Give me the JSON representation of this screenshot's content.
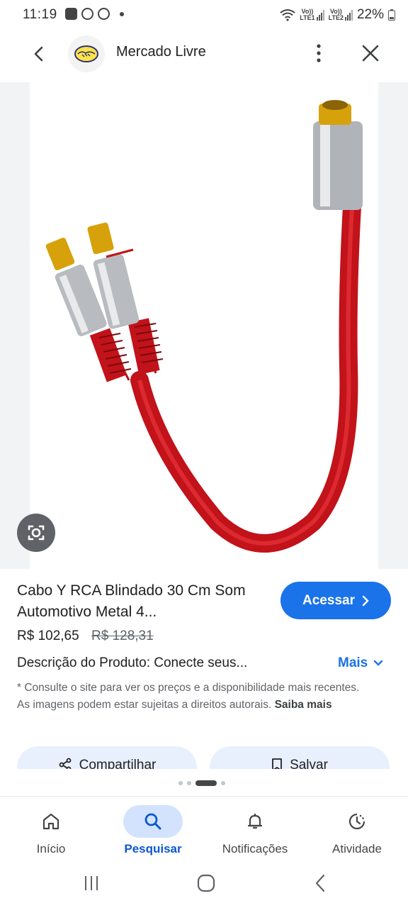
{
  "status_bar": {
    "time": "11:19",
    "battery": "22%",
    "sim1": "LTE1",
    "sim2": "LTE2",
    "volte": "Vo))"
  },
  "header": {
    "site_name": "Mercado Livre",
    "icons": [
      "back-arrow-icon",
      "mercado-livre-logo",
      "more-vert-icon",
      "close-icon"
    ]
  },
  "product": {
    "title": "Cabo Y RCA Blindado 30 Cm Som Automotivo Metal 4...",
    "price": "R$ 102,65",
    "old_price": "R$ 128,31",
    "access_label": "Acessar",
    "description": "Descrição do Produto: Conecte seus...",
    "more_label": "Mais",
    "disclaimer": "* Consulte o site para ver os preços e a disponibilidade mais recentes. As imagens podem estar sujeitas a direitos autorais.",
    "learn_more": "Saiba mais",
    "share_label": "Compartilhar",
    "save_label": "Salvar",
    "image_description": ""
  },
  "colors": {
    "accent": "#1a73e8",
    "nav_active_bg": "#d3e3fd",
    "nav_active_text": "#0b57d0",
    "cable_red": "#d0141c"
  },
  "bottom_nav": {
    "items": [
      {
        "label": "Início",
        "icon": "home-icon",
        "active": false
      },
      {
        "label": "Pesquisar",
        "icon": "search-icon",
        "active": true
      },
      {
        "label": "Notificações",
        "icon": "bell-icon",
        "active": false
      },
      {
        "label": "Atividade",
        "icon": "activity-icon",
        "active": false
      }
    ]
  },
  "carousel": {
    "pages": 4,
    "active_index": 2
  }
}
